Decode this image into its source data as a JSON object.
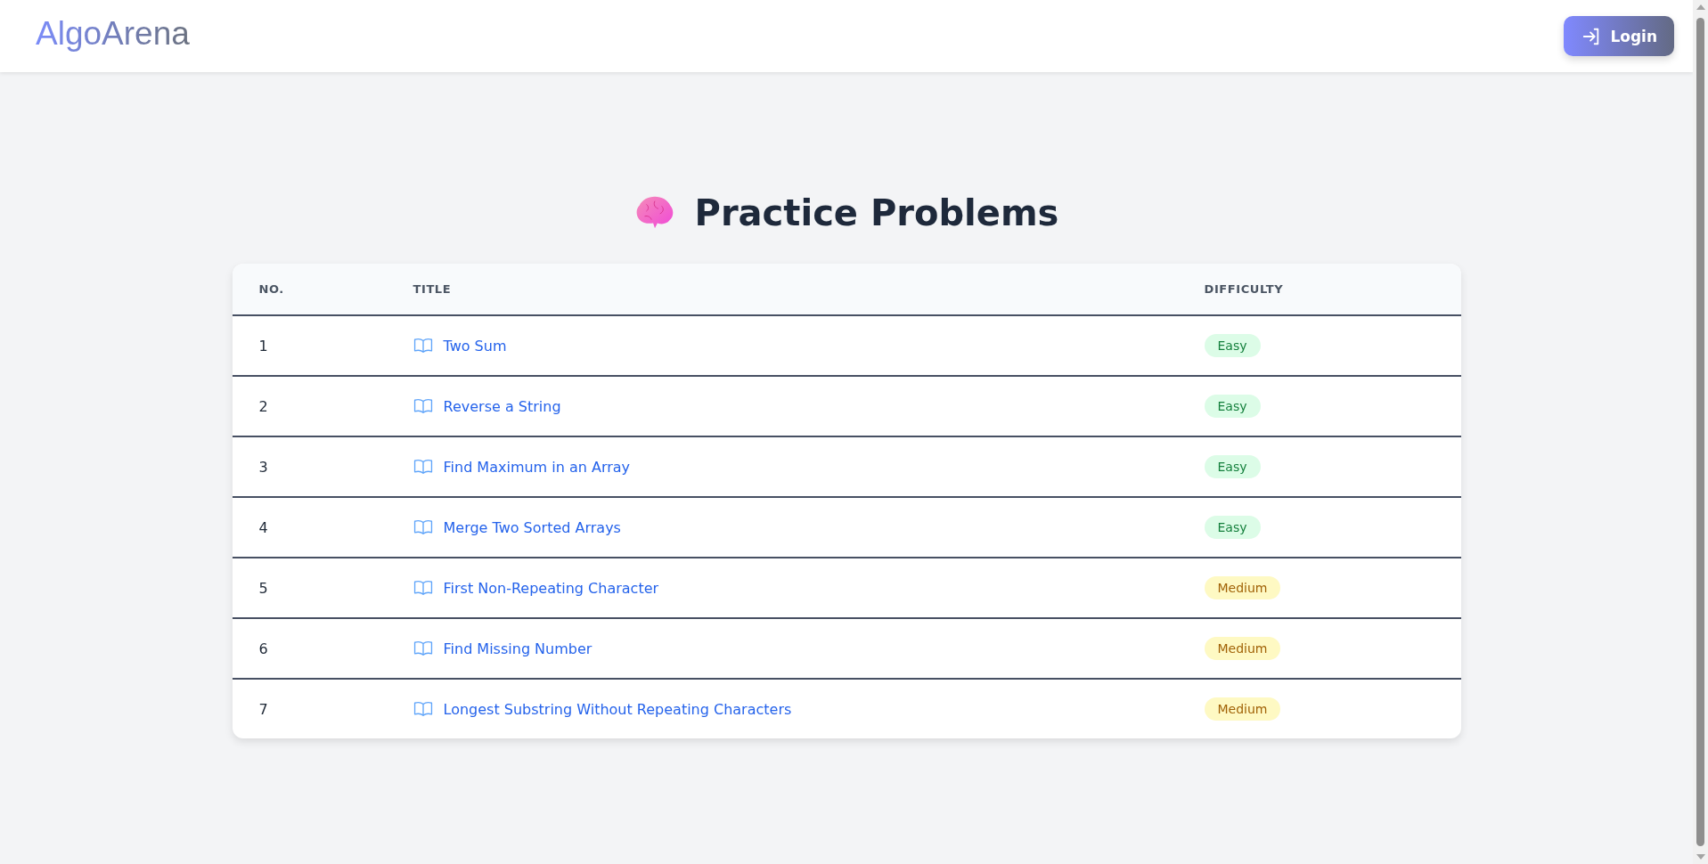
{
  "header": {
    "logo": "AlgoArena",
    "login_button": "Login"
  },
  "heading": "Practice Problems",
  "table": {
    "columns": [
      "NO.",
      "TITLE",
      "DIFFICULTY"
    ],
    "rows": [
      {
        "no": "1",
        "title": "Two Sum",
        "difficulty": "Easy",
        "kind": "easy"
      },
      {
        "no": "2",
        "title": "Reverse a String",
        "difficulty": "Easy",
        "kind": "easy"
      },
      {
        "no": "3",
        "title": "Find Maximum in an Array",
        "difficulty": "Easy",
        "kind": "easy"
      },
      {
        "no": "4",
        "title": "Merge Two Sorted Arrays",
        "difficulty": "Easy",
        "kind": "easy"
      },
      {
        "no": "5",
        "title": "First Non-Repeating Character",
        "difficulty": "Medium",
        "kind": "medium"
      },
      {
        "no": "6",
        "title": "Find Missing Number",
        "difficulty": "Medium",
        "kind": "medium"
      },
      {
        "no": "7",
        "title": "Longest Substring Without Repeating Characters",
        "difficulty": "Medium",
        "kind": "medium"
      }
    ]
  }
}
